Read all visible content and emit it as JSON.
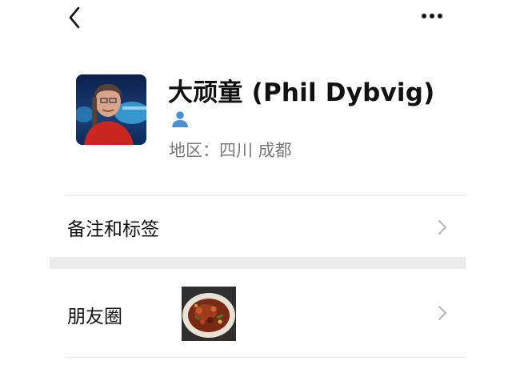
{
  "profile": {
    "name": "大顽童 (Phil Dybvig)",
    "region": "地区：四川 成都",
    "gender_icon": "person-icon",
    "gender_color": "#4a90d9"
  },
  "rows": {
    "remarks_label": "备注和标签",
    "moments_label": "朋友圈"
  },
  "icons": {
    "back": "chevron-left-icon",
    "more": "more-dots-icon",
    "chevron": "chevron-right-icon"
  }
}
